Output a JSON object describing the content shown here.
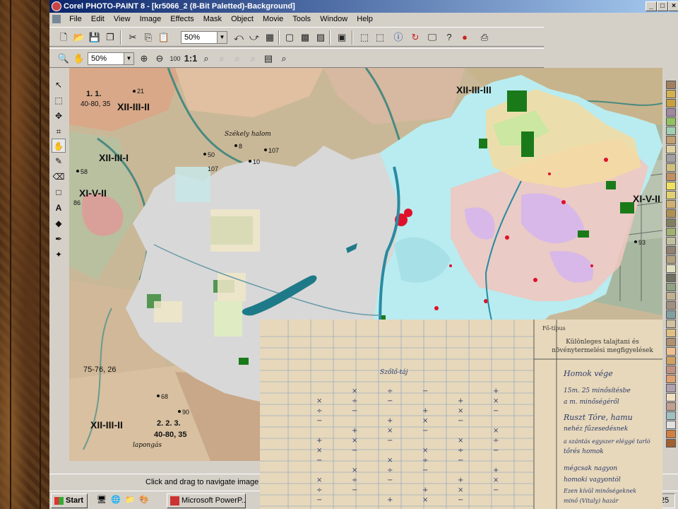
{
  "window": {
    "title": "Corel PHOTO-PAINT 8 - [kr5066_2  (8-Bit Paletted)-Background]",
    "controls": [
      "_",
      "□",
      "×"
    ]
  },
  "menubar": {
    "items": [
      "File",
      "Edit",
      "View",
      "Image",
      "Effects",
      "Mask",
      "Object",
      "Movie",
      "Tools",
      "Window",
      "Help"
    ]
  },
  "toolbar1": {
    "zoom_value": "50%"
  },
  "toolbar2": {
    "zoom_value": "50%",
    "ratio_label": "1:1"
  },
  "map": {
    "labels": [
      "1.   1.",
      "40-80, 35",
      "XII-III-II",
      "XII-III-I",
      "XI-V-II",
      "XII-III-III",
      "XI-V-II",
      "75-76, 26",
      "XII-III-II",
      "2.   2.   3.",
      "40-80, 35",
      "Székely halom",
      "lapongás"
    ],
    "numbers": [
      "21",
      "8",
      "10",
      "58",
      "50",
      "107",
      "86",
      "93",
      "68",
      "90",
      "107"
    ]
  },
  "document": {
    "col_header": "Fő-típus",
    "heading": "Különleges talajtani és növénytermelési megfigyelések",
    "handwriting": [
      "Homok vége",
      "15m. 25   minősítésbe",
      "a m. minőségéről",
      "Ruszt Tóre, hamu",
      "nehéz fűzesedésnek",
      "a szántás egyszer eléggé tarló",
      "tőrés homok",
      "mégcsak nagyon",
      "homoki vagyontól",
      "Ezen kívül minőségeknek",
      "minő (Vitaly) hazár",
      "Szőlő-táj"
    ]
  },
  "statusbar": {
    "text": "Click and drag to navigate image"
  },
  "taskbar": {
    "start_label": "Start",
    "active_task": "Microsoft PowerP...",
    "clock": "25"
  },
  "colors": {
    "titlebar_start": "#0a246a",
    "titlebar_end": "#a6caf0",
    "chrome": "#d4d0c8",
    "country_gray": "#d8d8d8",
    "danube_blue": "#2a8aa0",
    "balaton_teal": "#1e7a88",
    "urban_red": "#e0102a",
    "forest_green": "#1a7a1a"
  },
  "palette": [
    "#a08060",
    "#d4b050",
    "#c8a040",
    "#a088a0",
    "#90c060",
    "#a0d0b0",
    "#c0a070",
    "#e0d0a0",
    "#a0a0a0",
    "#d0c080",
    "#c09060",
    "#f0e060",
    "#e0d070",
    "#d0b070",
    "#b09050",
    "#808060",
    "#a0b070",
    "#c0c0a0",
    "#908070",
    "#b0a080",
    "#e0e0c0",
    "#707060",
    "#90a080",
    "#c0b090",
    "#a09080",
    "#80a0a0",
    "#d0c0a0",
    "#e0c080",
    "#b09070",
    "#f0c090",
    "#d0a060",
    "#c09080",
    "#e0a070",
    "#b0a0b0",
    "#f0e0c0",
    "#c0a090",
    "#a0c0c0",
    "#e0e0e0",
    "#d08040",
    "#a06030"
  ]
}
